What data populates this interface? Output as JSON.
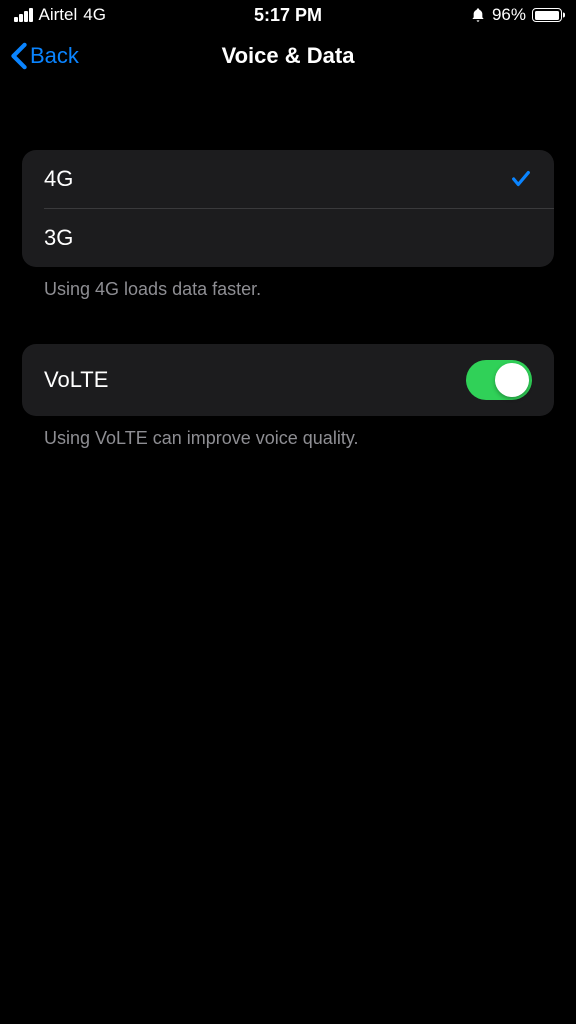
{
  "status": {
    "carrier": "Airtel",
    "network": "4G",
    "time": "5:17 PM",
    "battery": "96%"
  },
  "nav": {
    "back": "Back",
    "title": "Voice & Data"
  },
  "options": {
    "item1": "4G",
    "item2": "3G",
    "footer": "Using 4G loads data faster."
  },
  "volte": {
    "label": "VoLTE",
    "footer": "Using VoLTE can improve voice quality."
  }
}
